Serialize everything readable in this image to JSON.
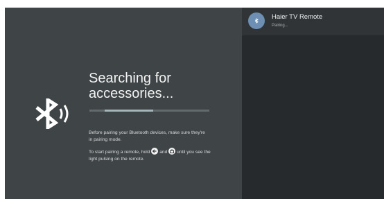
{
  "pairing_screen": {
    "title": "Searching for accessories...",
    "progress": 0.6,
    "instruction_1": "Before pairing your Bluetooth devices, make sure they're in pairing mode.",
    "instruction_2_prefix": "To start pairing a remote, hold",
    "instruction_2_and": "and",
    "instruction_2_suffix": "until you see the light pulsing on the remote.",
    "icons": [
      "bluetooth-searching-icon",
      "back-arrow-icon",
      "home-icon"
    ]
  },
  "device_list": {
    "devices": [
      {
        "name": "Haier TV Remote",
        "status": "Pairing...",
        "icon": "bluetooth-device-icon"
      }
    ]
  },
  "colors": {
    "background": "#3f4446",
    "panel": "#272a2c",
    "selected_row": "#303436",
    "avatar": "#6d8fb4",
    "progress_fill": "#a5b5ba",
    "progress_track": "#636a6c"
  }
}
